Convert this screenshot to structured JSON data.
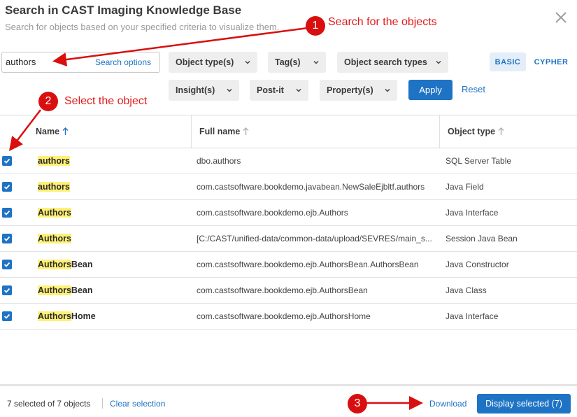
{
  "dialog": {
    "title": "Search in CAST Imaging Knowledge Base",
    "subtitle": "Search for objects based on your specified criteria to visualize them.",
    "close_icon": "close-icon"
  },
  "search": {
    "value": "authors",
    "options_label": "Search options"
  },
  "filters": {
    "object_types": "Object type(s)",
    "tags": "Tag(s)",
    "object_search_types": "Object search types",
    "insights": "Insight(s)",
    "post_it": "Post-it",
    "properties": "Property(s)"
  },
  "mode": {
    "basic": "BASIC",
    "cypher": "CYPHER",
    "selected": "BASIC"
  },
  "actions": {
    "apply": "Apply",
    "reset": "Reset"
  },
  "table": {
    "columns": {
      "name": "Name",
      "full_name": "Full name",
      "object_type": "Object type"
    },
    "sort_icon": "sort-arrow-up-icon",
    "rows": [
      {
        "checked": true,
        "name_match": "authors",
        "name_rest": "",
        "full_name": "dbo.authors",
        "object_type": "SQL Server Table"
      },
      {
        "checked": true,
        "name_match": "authors",
        "name_rest": "",
        "full_name": "com.castsoftware.bookdemo.javabean.NewSaleEjbltf.authors",
        "object_type": "Java Field"
      },
      {
        "checked": true,
        "name_match": "Authors",
        "name_rest": "",
        "full_name": "com.castsoftware.bookdemo.ejb.Authors",
        "object_type": "Java Interface"
      },
      {
        "checked": true,
        "name_match": "Authors",
        "name_rest": "",
        "full_name": "[C:/CAST/unified-data/common-data/upload/SEVRES/main_s...",
        "object_type": "Session Java Bean"
      },
      {
        "checked": true,
        "name_match": "Authors",
        "name_rest": "Bean",
        "full_name": "com.castsoftware.bookdemo.ejb.AuthorsBean.AuthorsBean",
        "object_type": "Java Constructor"
      },
      {
        "checked": true,
        "name_match": "Authors",
        "name_rest": "Bean",
        "full_name": "com.castsoftware.bookdemo.ejb.AuthorsBean",
        "object_type": "Java Class"
      },
      {
        "checked": true,
        "name_match": "Authors",
        "name_rest": "Home",
        "full_name": "com.castsoftware.bookdemo.ejb.AuthorsHome",
        "object_type": "Java Interface"
      }
    ]
  },
  "footer": {
    "selection_text": "7 selected of 7  objects",
    "clear_selection": "Clear selection",
    "download": "Download",
    "display_selected": "Display selected (7)"
  },
  "annotations": {
    "color": "#e11b1b",
    "steps": [
      {
        "number": "1",
        "label": "Search for the objects"
      },
      {
        "number": "2",
        "label": "Select the object"
      },
      {
        "number": "3",
        "label": ""
      }
    ]
  },
  "colors": {
    "accent": "#1f73c4",
    "highlight": "#fff176",
    "annotation": "#d90f0f"
  }
}
